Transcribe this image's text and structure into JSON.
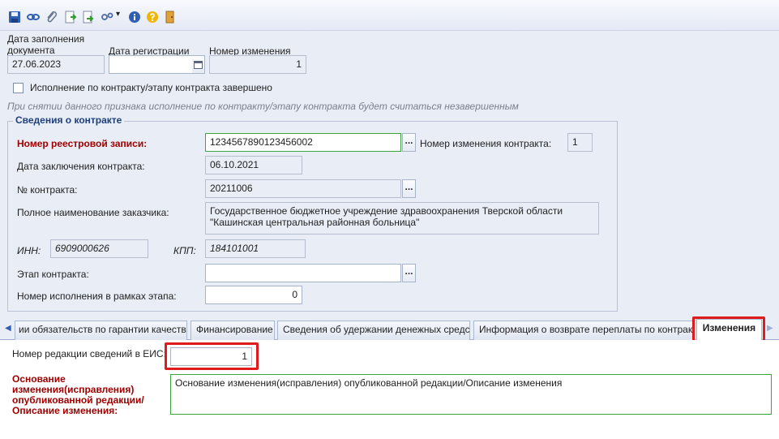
{
  "toolbar": {
    "icons": [
      "save-icon",
      "link-icon",
      "attach-icon",
      "document-forward-icon",
      "document-export-icon",
      "workflow-icon",
      "info-icon",
      "help-icon",
      "exit-icon"
    ],
    "dropdown_glyph": "▾"
  },
  "form": {
    "fill_date_label": "Дата заполнения документа",
    "fill_date_value": "27.06.2023",
    "reg_date_label": "Дата регистрации",
    "reg_date_value": "",
    "change_no_label": "Номер изменения",
    "change_no_value": "1",
    "completed_label": "Исполнение по контракту/этапу контракта завершено",
    "hint": "При снятии данного признака исполнение по контракту/этапу контракта будет считаться незавершенным"
  },
  "contract": {
    "group_title": "Сведения о контракте",
    "registry_label": "Номер реестровой записи:",
    "registry_value": "1234567890123456002",
    "contract_change_label": "Номер изменения контракта:",
    "contract_change_value": "1",
    "conclusion_date_label": "Дата заключения контракта:",
    "conclusion_date_value": "06.10.2021",
    "number_label": "№ контракта:",
    "number_value": "20211006",
    "customer_label": "Полное наименование заказчика:",
    "customer_value": "Государственное бюджетное учреждение здравоохранения Тверской области \"Кашинская центральная районная больница\"",
    "inn_label": "ИНН:",
    "inn_value": "6909000626",
    "kpp_label": "КПП:",
    "kpp_value": "184101001",
    "stage_label": "Этап контракта:",
    "stage_value": "",
    "exec_no_label": "Номер исполнения в рамках этапа:",
    "exec_no_value": "0"
  },
  "tabs": {
    "left_arrow": "◀",
    "right_arrow": "▶",
    "items": [
      "ии обязательств по гарантии качества",
      "Финансирование",
      "Сведения об удержании денежных средств",
      "Информация о возврате переплаты по контракту",
      "Изменения"
    ]
  },
  "changes": {
    "edition_label": "Номер редакции сведений в ЕИС:",
    "edition_value": "1",
    "reason_label": "Основание изменения(исправления) опубликованной редакции/ Описание изменения:",
    "reason_value": "Основание изменения(исправления) опубликованной редакции/Описание изменения"
  },
  "colors": {
    "accent_red": "#a00000",
    "highlight_red": "#e01b1b",
    "valid_green": "#3aa53a"
  }
}
